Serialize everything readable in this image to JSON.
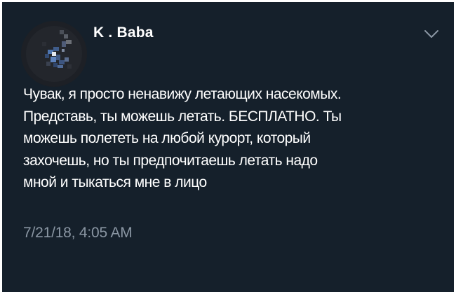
{
  "tweet": {
    "author": {
      "name": "K . Baba"
    },
    "text_lines": [
      "Чувак, я просто ненавижу летающих насекомых.",
      "Представь, ты можешь летать. БЕСПЛАТНО. Ты",
      "можешь полететь на любой курорт, который",
      "захочешь, но ты предпочитаешь летать надо",
      "мной и тыкаться мне в лицо"
    ],
    "timestamp": "7/21/18, 4:05 AM"
  },
  "icons": {
    "avatar": "avatar-image",
    "menu": "chevron-down-icon"
  },
  "colors": {
    "background": "#15202b",
    "text": "#ffffff",
    "secondary_text": "#8a96a3",
    "frame": "#ffffff"
  }
}
